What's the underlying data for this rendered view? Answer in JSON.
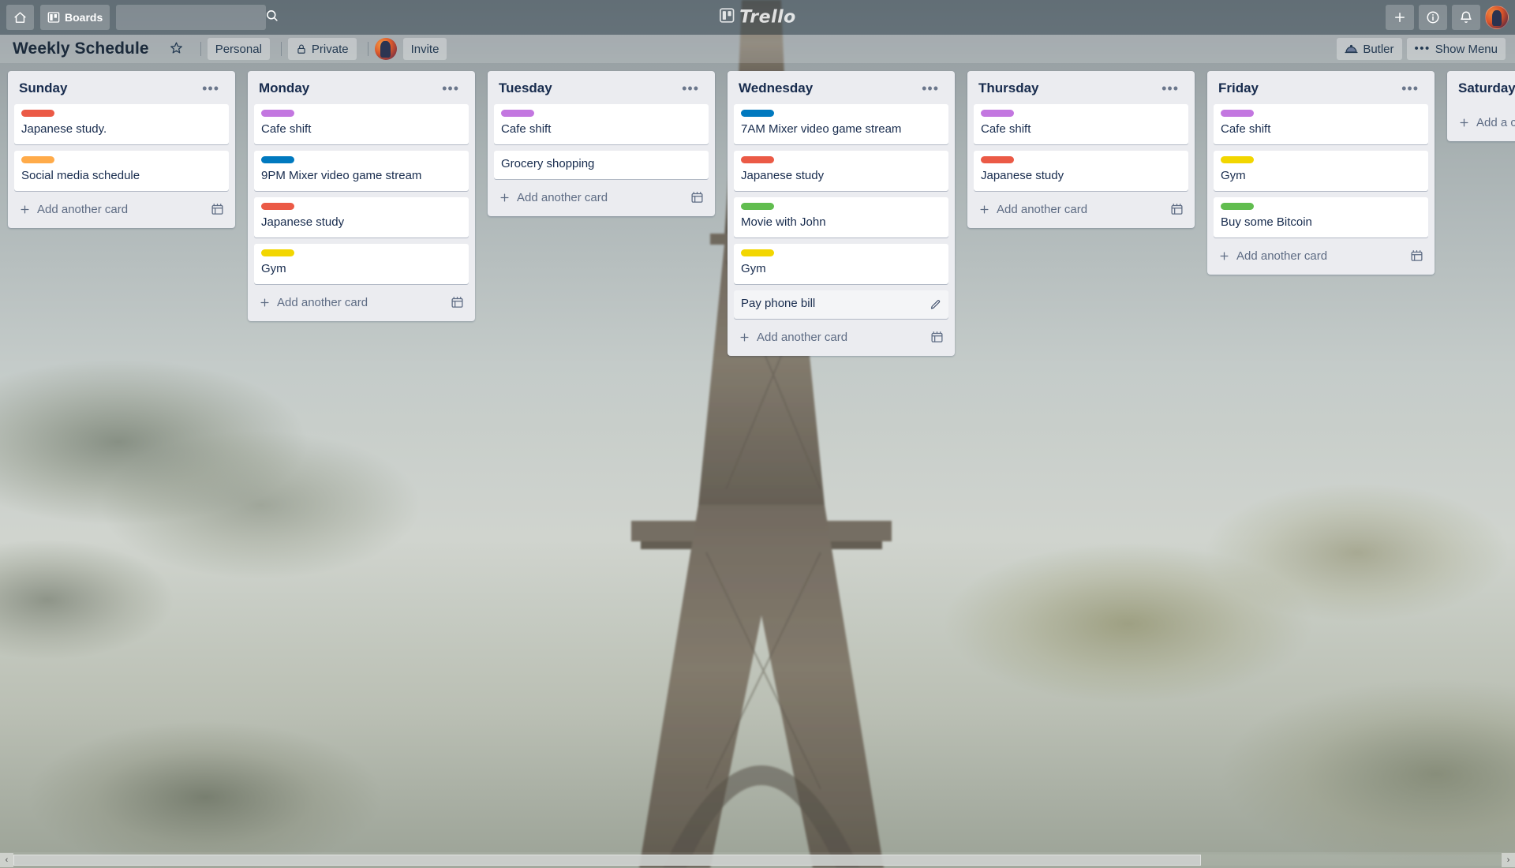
{
  "topbar": {
    "home_icon": "home-icon",
    "boards_label": "Boards",
    "boards_icon": "boards-grid-icon",
    "search_placeholder": "",
    "search_value": "",
    "search_icon": "search-icon",
    "logo_text": "Trello",
    "logo_icon": "trello-logo-icon",
    "add_icon": "plus-icon",
    "info_icon": "info-circle-icon",
    "notifications_icon": "bell-icon",
    "avatar": "user-avatar"
  },
  "board_header": {
    "title": "Weekly Schedule",
    "star_icon": "star-icon",
    "team_label": "Personal",
    "visibility_label": "Private",
    "visibility_icon": "lock-icon",
    "member_avatar": "member-avatar",
    "invite_label": "Invite",
    "butler_label": "Butler",
    "butler_icon": "butler-dome-icon",
    "show_menu_label": "Show Menu",
    "show_menu_icon": "ellipsis-icon"
  },
  "colors": {
    "label_red": "#eb5a46",
    "label_orange": "#ffab4a",
    "label_purple": "#c377e0",
    "label_blue": "#0079bf",
    "label_green": "#61bd4f",
    "label_yellow": "#f2d600",
    "list_bg": "#ebecf0",
    "card_bg": "#ffffff",
    "text": "#172b4d"
  },
  "add_card_text": "Add another card",
  "add_card_icon": "plus-icon",
  "template_icon": "card-template-icon",
  "list_menu_icon": "ellipsis-icon",
  "edit_icon": "pencil-icon",
  "lists": [
    {
      "title": "Sunday",
      "cards": [
        {
          "title": "Japanese study.",
          "label_color": "#eb5a46",
          "label_name": "red",
          "hovered": false
        },
        {
          "title": "Social media schedule",
          "label_color": "#ffab4a",
          "label_name": "orange",
          "hovered": false
        }
      ],
      "add_card_text": "Add another card"
    },
    {
      "title": "Monday",
      "cards": [
        {
          "title": "Cafe shift",
          "label_color": "#c377e0",
          "label_name": "purple",
          "hovered": false
        },
        {
          "title": "9PM Mixer video game stream",
          "label_color": "#0079bf",
          "label_name": "blue",
          "hovered": false
        },
        {
          "title": "Japanese study",
          "label_color": "#eb5a46",
          "label_name": "red",
          "hovered": false
        },
        {
          "title": "Gym",
          "label_color": "#f2d600",
          "label_name": "yellow",
          "hovered": false
        }
      ],
      "add_card_text": "Add another card"
    },
    {
      "title": "Tuesday",
      "cards": [
        {
          "title": "Cafe shift",
          "label_color": "#c377e0",
          "label_name": "purple",
          "hovered": false
        },
        {
          "title": "Grocery shopping",
          "label_color": null,
          "label_name": null,
          "hovered": false
        }
      ],
      "add_card_text": "Add another card"
    },
    {
      "title": "Wednesday",
      "cards": [
        {
          "title": "7AM Mixer video game stream",
          "label_color": "#0079bf",
          "label_name": "blue",
          "hovered": false
        },
        {
          "title": "Japanese study",
          "label_color": "#eb5a46",
          "label_name": "red",
          "hovered": false
        },
        {
          "title": "Movie with John",
          "label_color": "#61bd4f",
          "label_name": "green",
          "hovered": false
        },
        {
          "title": "Gym",
          "label_color": "#f2d600",
          "label_name": "yellow",
          "hovered": false
        },
        {
          "title": "Pay phone bill",
          "label_color": null,
          "label_name": null,
          "hovered": true
        }
      ],
      "add_card_text": "Add another card"
    },
    {
      "title": "Thursday",
      "cards": [
        {
          "title": "Cafe shift",
          "label_color": "#c377e0",
          "label_name": "purple",
          "hovered": false
        },
        {
          "title": "Japanese study",
          "label_color": "#eb5a46",
          "label_name": "red",
          "hovered": false
        }
      ],
      "add_card_text": "Add another card"
    },
    {
      "title": "Friday",
      "cards": [
        {
          "title": "Cafe shift",
          "label_color": "#c377e0",
          "label_name": "purple",
          "hovered": false
        },
        {
          "title": "Gym",
          "label_color": "#f2d600",
          "label_name": "yellow",
          "hovered": false
        },
        {
          "title": "Buy some Bitcoin",
          "label_color": "#61bd4f",
          "label_name": "green",
          "hovered": false
        }
      ],
      "add_card_text": "Add another card"
    },
    {
      "title": "Saturday",
      "cards": [],
      "add_card_text": "Add a card"
    }
  ],
  "scrollbar": {
    "left_arrow": "chevron-left-icon",
    "right_arrow": "chevron-right-icon"
  }
}
